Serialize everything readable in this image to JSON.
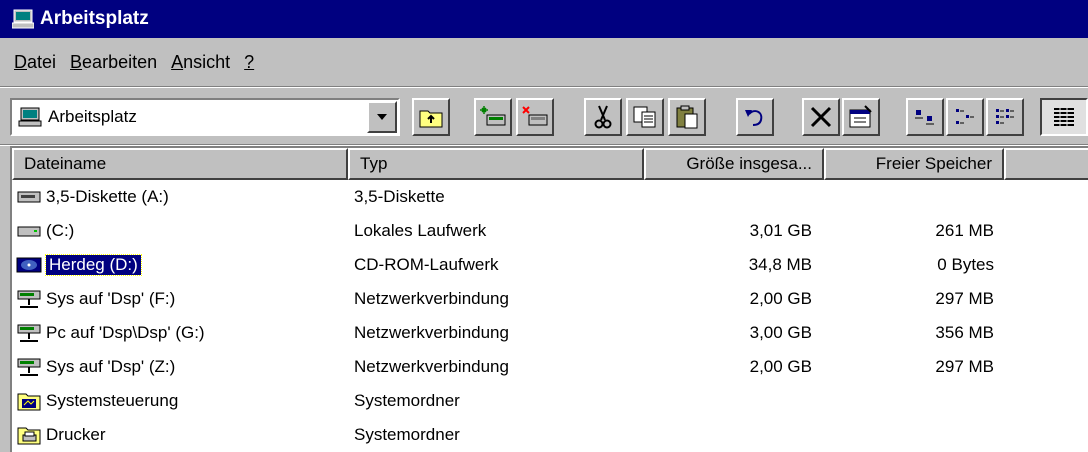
{
  "window": {
    "title": "Arbeitsplatz"
  },
  "menu": [
    {
      "label": "Datei",
      "accel": "D",
      "rest": "atei"
    },
    {
      "label": "Bearbeiten",
      "accel": "B",
      "rest": "earbeiten"
    },
    {
      "label": "Ansicht",
      "accel": "A",
      "rest": "nsicht"
    },
    {
      "label": "?",
      "accel": "?",
      "rest": ""
    }
  ],
  "toolbar": {
    "address_value": "Arbeitsplatz",
    "buttons": [
      "up-folder",
      "map-drive",
      "disconnect-drive",
      "cut",
      "copy",
      "paste",
      "undo",
      "delete",
      "properties",
      "large-icons",
      "small-icons",
      "list",
      "details"
    ]
  },
  "columns": {
    "name": "Dateiname",
    "type": "Typ",
    "size": "Größe insgesa...",
    "free": "Freier Speicher"
  },
  "rows": [
    {
      "name": "3,5-Diskette (A:)",
      "type": "3,5-Diskette",
      "size": "",
      "free": "",
      "icon": "floppy-drive-icon",
      "selected": false
    },
    {
      "name": "(C:)",
      "type": "Lokales Laufwerk",
      "size": "3,01 GB",
      "free": "261 MB",
      "icon": "hard-drive-icon",
      "selected": false
    },
    {
      "name": "Herdeg (D:)",
      "type": "CD-ROM-Laufwerk",
      "size": "34,8 MB",
      "free": "0 Bytes",
      "icon": "cdrom-icon",
      "selected": true
    },
    {
      "name": "Sys auf 'Dsp' (F:)",
      "type": "Netzwerkverbindung",
      "size": "2,00 GB",
      "free": "297 MB",
      "icon": "network-drive-icon",
      "selected": false
    },
    {
      "name": "Pc auf 'Dsp\\Dsp' (G:)",
      "type": "Netzwerkverbindung",
      "size": "3,00 GB",
      "free": "356 MB",
      "icon": "network-drive-icon",
      "selected": false
    },
    {
      "name": "Sys auf 'Dsp' (Z:)",
      "type": "Netzwerkverbindung",
      "size": "2,00 GB",
      "free": "297 MB",
      "icon": "network-drive-icon",
      "selected": false
    },
    {
      "name": "Systemsteuerung",
      "type": "Systemordner",
      "size": "",
      "free": "",
      "icon": "control-panel-icon",
      "selected": false
    },
    {
      "name": "Drucker",
      "type": "Systemordner",
      "size": "",
      "free": "",
      "icon": "printers-folder-icon",
      "selected": false
    }
  ],
  "colors": {
    "titlebar": "#000080",
    "face": "#c0c0c0",
    "selection": "#000080"
  }
}
